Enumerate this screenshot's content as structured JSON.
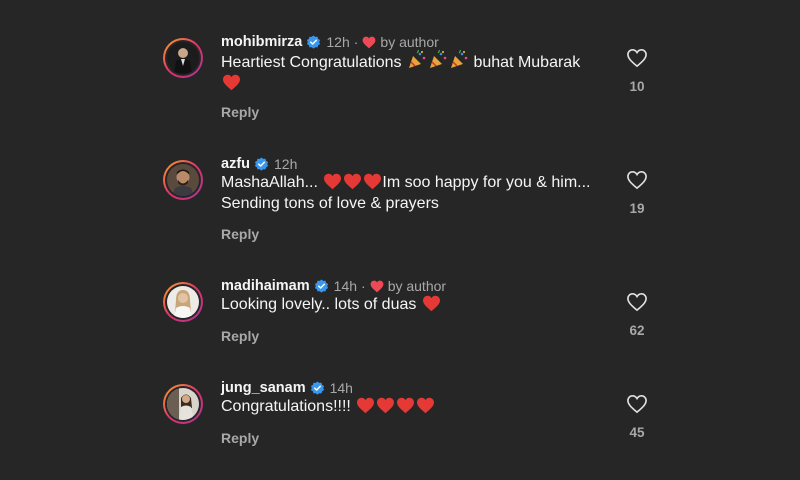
{
  "colors": {
    "background": "#262626",
    "text": "#f5f5f5",
    "muted": "#a8a8a8",
    "verified": "#3897f0",
    "heart": "#ed4956"
  },
  "comments": [
    {
      "username": "mohibmirza",
      "verified": true,
      "time": "12h",
      "liked_by_author": true,
      "by_author_label": "by author",
      "text_before": "Heartiest Congratulations",
      "emojis_mid": [
        "party-popper-icon",
        "party-popper-icon",
        "party-popper-icon"
      ],
      "text_after": "buhat Mubarak",
      "emojis_end": [
        "red-heart-icon"
      ],
      "reply_label": "Reply",
      "like_count": "10"
    },
    {
      "username": "azfu",
      "verified": true,
      "time": "12h",
      "liked_by_author": false,
      "text_before": "MashaAllah...",
      "emojis_mid": [
        "red-heart-icon",
        "red-heart-icon",
        "red-heart-icon"
      ],
      "text_after": "Im soo happy for you & him... Sending tons of love & prayers",
      "emojis_end": [],
      "reply_label": "Reply",
      "like_count": "19"
    },
    {
      "username": "madihaimam",
      "verified": true,
      "time": "14h",
      "liked_by_author": true,
      "by_author_label": "by author",
      "text_before": "Looking lovely.. lots of duas",
      "emojis_mid": [],
      "text_after": "",
      "emojis_end": [
        "red-heart-icon"
      ],
      "reply_label": "Reply",
      "like_count": "62"
    },
    {
      "username": "jung_sanam",
      "verified": true,
      "time": "14h",
      "liked_by_author": false,
      "text_before": "Congratulations!!!!",
      "emojis_mid": [],
      "text_after": "",
      "emojis_end": [
        "red-heart-icon",
        "red-heart-icon",
        "red-heart-icon",
        "red-heart-icon"
      ],
      "reply_label": "Reply",
      "like_count": "45"
    }
  ]
}
